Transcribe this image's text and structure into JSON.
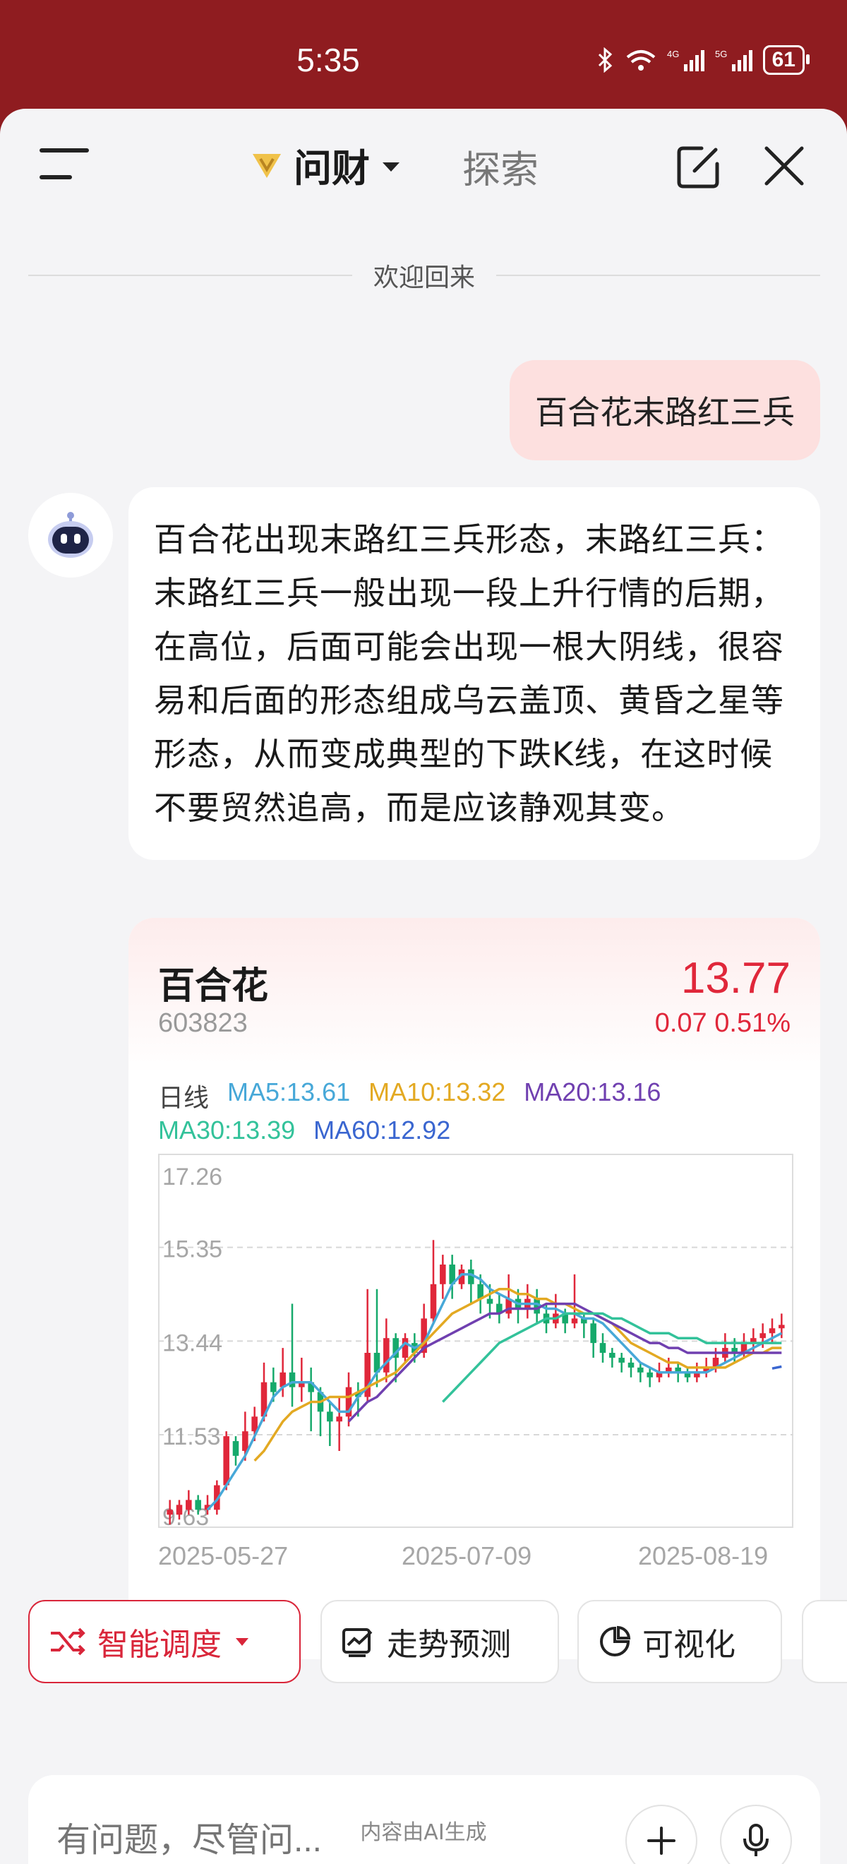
{
  "status_bar": {
    "time": "5:35",
    "network": "5G",
    "battery": "61"
  },
  "nav": {
    "tab_active": "问财",
    "tab_other": "探索"
  },
  "welcome": "欢迎回来",
  "user_message": "百合花末路红三兵",
  "ai_message": "百合花出现末路红三兵形态，末路红三兵：末路红三兵一般出现一段上升行情的后期，在高位，后面可能会出现一根大阴线，很容易和后面的形态组成乌云盖顶、黄昏之星等形态，从而变成典型的下跌K线，在这时候不要贸然追高，而是应该静观其变。",
  "stock": {
    "name": "百合花",
    "code": "603823",
    "price": "13.77",
    "change": "0.07 0.51%",
    "period": "日线",
    "ma5": "MA5:13.61",
    "ma10": "MA10:13.32",
    "ma20": "MA20:13.16",
    "ma30": "MA30:13.39",
    "ma60": "MA60:12.92",
    "colors": {
      "up": "#e0273a",
      "down": "#16a96b",
      "ma5": "#47a8d8",
      "ma10": "#e3a922",
      "ma20": "#7040b0",
      "ma30": "#33c29a",
      "ma60": "#3a66d0"
    }
  },
  "chart_data": {
    "type": "candlestick",
    "y_ticks": [
      "17.26",
      "15.35",
      "13.44",
      "11.53",
      "9.63"
    ],
    "ylim": [
      9.63,
      17.26
    ],
    "x_ticks": [
      "2025-05-27",
      "2025-07-09",
      "2025-08-19"
    ],
    "candles": [
      [
        9.9,
        10.0,
        9.7,
        10.2
      ],
      [
        9.9,
        10.1,
        9.8,
        10.2
      ],
      [
        10.0,
        10.2,
        9.9,
        10.4
      ],
      [
        10.2,
        10.0,
        9.9,
        10.3
      ],
      [
        10.0,
        10.1,
        9.9,
        10.3
      ],
      [
        10.0,
        10.5,
        9.9,
        10.6
      ],
      [
        10.5,
        11.5,
        10.4,
        11.6
      ],
      [
        11.4,
        11.1,
        10.9,
        11.5
      ],
      [
        11.2,
        11.6,
        11.0,
        12.0
      ],
      [
        11.6,
        11.9,
        11.4,
        12.1
      ],
      [
        11.9,
        12.6,
        11.8,
        13.0
      ],
      [
        12.6,
        12.4,
        12.2,
        12.9
      ],
      [
        12.5,
        12.8,
        12.3,
        13.3
      ],
      [
        12.8,
        12.5,
        12.1,
        14.2
      ],
      [
        12.5,
        12.6,
        12.2,
        13.1
      ],
      [
        12.6,
        12.4,
        11.6,
        12.9
      ],
      [
        12.4,
        12.0,
        11.5,
        12.5
      ],
      [
        12.0,
        11.8,
        11.3,
        12.2
      ],
      [
        11.8,
        11.9,
        11.2,
        12.3
      ],
      [
        11.9,
        12.5,
        11.7,
        12.8
      ],
      [
        12.4,
        12.3,
        11.9,
        12.6
      ],
      [
        12.3,
        13.2,
        12.2,
        14.5
      ],
      [
        13.2,
        12.8,
        12.5,
        14.5
      ],
      [
        12.8,
        13.5,
        12.6,
        13.9
      ],
      [
        13.5,
        13.1,
        12.6,
        13.6
      ],
      [
        13.1,
        13.5,
        13.0,
        13.6
      ],
      [
        13.4,
        13.2,
        13.0,
        13.6
      ],
      [
        13.2,
        13.9,
        13.1,
        14.2
      ],
      [
        13.9,
        14.6,
        13.8,
        15.5
      ],
      [
        14.6,
        15.0,
        14.3,
        15.2
      ],
      [
        15.0,
        14.6,
        14.3,
        15.2
      ],
      [
        14.6,
        14.9,
        14.5,
        15.0
      ],
      [
        14.9,
        14.6,
        14.2,
        15.1
      ],
      [
        14.6,
        14.3,
        14.0,
        14.8
      ],
      [
        14.3,
        14.2,
        13.9,
        14.6
      ],
      [
        14.2,
        14.0,
        13.8,
        14.4
      ],
      [
        14.0,
        14.3,
        13.9,
        14.8
      ],
      [
        14.3,
        14.1,
        13.8,
        14.5
      ],
      [
        14.1,
        14.3,
        13.9,
        14.6
      ],
      [
        14.3,
        14.0,
        13.8,
        14.5
      ],
      [
        14.0,
        13.8,
        13.6,
        14.2
      ],
      [
        13.8,
        14.0,
        13.7,
        14.4
      ],
      [
        14.0,
        13.8,
        13.6,
        14.1
      ],
      [
        13.8,
        13.9,
        13.7,
        14.8
      ],
      [
        13.9,
        13.8,
        13.5,
        14.0
      ],
      [
        13.8,
        13.4,
        13.1,
        13.9
      ],
      [
        13.4,
        13.2,
        13.0,
        13.6
      ],
      [
        13.2,
        13.1,
        12.9,
        13.3
      ],
      [
        13.1,
        13.0,
        12.8,
        13.2
      ],
      [
        13.0,
        12.9,
        12.7,
        13.1
      ],
      [
        12.9,
        12.8,
        12.6,
        13.0
      ],
      [
        12.8,
        12.7,
        12.5,
        12.9
      ],
      [
        12.7,
        12.8,
        12.6,
        13.0
      ],
      [
        12.8,
        12.9,
        12.7,
        13.1
      ],
      [
        12.9,
        12.8,
        12.6,
        13.0
      ],
      [
        12.8,
        12.7,
        12.6,
        12.9
      ],
      [
        12.7,
        12.8,
        12.6,
        13.0
      ],
      [
        12.8,
        12.9,
        12.7,
        13.1
      ],
      [
        12.9,
        13.1,
        12.8,
        13.3
      ],
      [
        13.1,
        13.3,
        13.0,
        13.6
      ],
      [
        13.3,
        13.2,
        13.0,
        13.5
      ],
      [
        13.2,
        13.4,
        13.1,
        13.6
      ],
      [
        13.4,
        13.5,
        13.2,
        13.7
      ],
      [
        13.5,
        13.6,
        13.3,
        13.8
      ],
      [
        13.6,
        13.7,
        13.4,
        13.9
      ],
      [
        13.7,
        13.77,
        13.5,
        14.0
      ]
    ],
    "ma_lines": [
      {
        "name": "MA5",
        "start": 4,
        "values": [
          10.0,
          10.2,
          10.5,
          10.8,
          11.1,
          11.5,
          11.9,
          12.3,
          12.5,
          12.6,
          12.6,
          12.6,
          12.4,
          12.2,
          12.0,
          12.0,
          12.3,
          12.5,
          12.8,
          13.0,
          13.2,
          13.4,
          13.3,
          13.4,
          13.8,
          14.2,
          14.6,
          14.8,
          14.8,
          14.7,
          14.5,
          14.4,
          14.3,
          14.2,
          14.2,
          14.2,
          14.1,
          14.1,
          14.0,
          14.0,
          13.9,
          13.9,
          13.8,
          13.6,
          13.4,
          13.2,
          13.0,
          12.9,
          12.8,
          12.8,
          12.8,
          12.8,
          12.8,
          12.8,
          12.9,
          13.0,
          13.1,
          13.2,
          13.3,
          13.4,
          13.5,
          13.6
        ]
      },
      {
        "name": "MA10",
        "start": 9,
        "values": [
          11.0,
          11.2,
          11.5,
          11.8,
          12.0,
          12.1,
          12.2,
          12.2,
          12.3,
          12.3,
          12.3,
          12.4,
          12.5,
          12.6,
          12.7,
          12.8,
          13.0,
          13.2,
          13.4,
          13.6,
          13.8,
          14.0,
          14.1,
          14.2,
          14.3,
          14.4,
          14.5,
          14.5,
          14.4,
          14.4,
          14.3,
          14.3,
          14.2,
          14.2,
          14.1,
          14.0,
          14.0,
          13.9,
          13.8,
          13.6,
          13.4,
          13.3,
          13.2,
          13.1,
          13.0,
          13.0,
          12.9,
          12.9,
          12.9,
          12.9,
          12.9,
          13.0,
          13.1,
          13.2,
          13.2,
          13.3,
          13.3
        ]
      },
      {
        "name": "MA20",
        "start": 19,
        "values": [
          11.8,
          12.0,
          12.2,
          12.3,
          12.5,
          12.7,
          12.9,
          13.1,
          13.3,
          13.4,
          13.5,
          13.6,
          13.7,
          13.8,
          13.9,
          14.0,
          14.0,
          14.1,
          14.1,
          14.1,
          14.1,
          14.2,
          14.2,
          14.2,
          14.2,
          14.1,
          14.0,
          13.9,
          13.8,
          13.7,
          13.6,
          13.5,
          13.4,
          13.4,
          13.3,
          13.3,
          13.2,
          13.2,
          13.2,
          13.2,
          13.2,
          13.2,
          13.2,
          13.2,
          13.2,
          13.2,
          13.2
        ]
      },
      {
        "name": "MA30",
        "start": 29,
        "values": [
          12.2,
          12.4,
          12.6,
          12.8,
          13.0,
          13.2,
          13.4,
          13.5,
          13.6,
          13.7,
          13.8,
          13.9,
          13.9,
          14.0,
          14.0,
          14.0,
          14.0,
          14.0,
          13.9,
          13.9,
          13.8,
          13.7,
          13.6,
          13.6,
          13.6,
          13.5,
          13.5,
          13.5,
          13.4,
          13.4,
          13.4,
          13.4,
          13.4,
          13.4,
          13.4,
          13.4,
          13.4
        ]
      },
      {
        "name": "MA60",
        "start": 64,
        "values": [
          12.88,
          12.92
        ]
      }
    ]
  },
  "chips": {
    "smart": "智能调度",
    "trend": "走势预测",
    "visual": "可视化"
  },
  "input": {
    "placeholder": "有问题，尽管问..."
  },
  "footer_note": "内容由AI生成"
}
